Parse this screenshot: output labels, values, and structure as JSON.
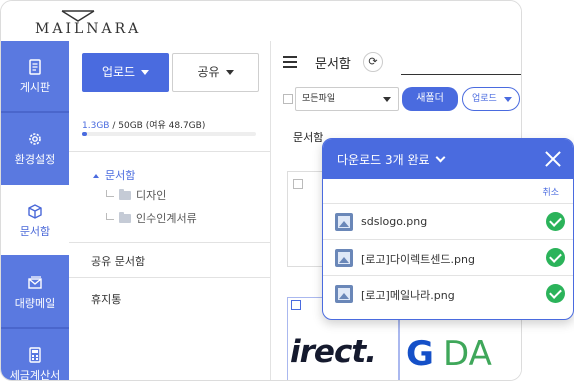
{
  "header": {
    "logo_text": "MAILNARA"
  },
  "rail": {
    "items": [
      {
        "label": "게시판",
        "icon": "board-icon"
      },
      {
        "label": "환경설정",
        "icon": "gear-icon"
      },
      {
        "label": "문서함",
        "icon": "box-icon",
        "active": true
      },
      {
        "label": "대량메일",
        "icon": "mail-icon"
      },
      {
        "label": "세금계산서",
        "icon": "calculator-icon"
      }
    ]
  },
  "sidebar": {
    "upload_label": "업로드",
    "share_label": "공유",
    "storage_used": "1.3GB",
    "storage_rest": "/ 50GB (여유 48.7GB)",
    "storage_fraction": 0.026,
    "tree_root": "문서함",
    "tree_children": [
      "디자인",
      "인수인계서류"
    ],
    "shared_label": "공유 문서함",
    "trash_label": "휴지통"
  },
  "main": {
    "title": "문서함",
    "refresh_icon": "refresh-icon",
    "filter_value": "모든파일",
    "new_folder_label": "새폴더",
    "upload_label": "업로드",
    "column_header": "문서함",
    "thumb_text_1": "irect.",
    "thumb_text_2a": "G",
    "thumb_text_2b": "DA"
  },
  "popup": {
    "title": "다운로드 3개 완료",
    "cancel_label": "취소",
    "files": [
      {
        "name": "sdslogo.png",
        "status": "done"
      },
      {
        "name": "[로고]다이렉트센드.png",
        "status": "done"
      },
      {
        "name": "[로고]메일나라.png",
        "status": "done"
      }
    ]
  },
  "colors": {
    "accent": "#4a6bdf",
    "rail": "#5a79e0",
    "success": "#2bb35a"
  }
}
